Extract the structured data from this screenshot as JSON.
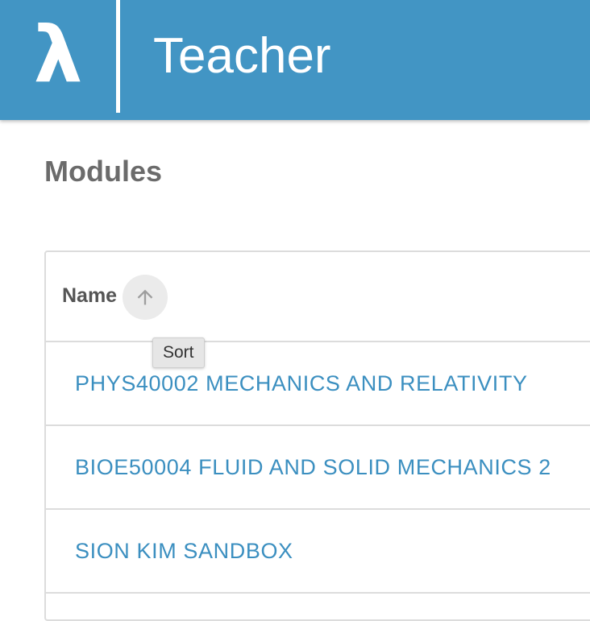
{
  "header": {
    "logo_glyph": "λ",
    "app_title": "Teacher",
    "brand_color": "#4295c4"
  },
  "page": {
    "title": "Modules"
  },
  "table": {
    "columns": [
      {
        "label": "Name",
        "sort_icon": "arrow-up-icon"
      }
    ],
    "tooltip": "Sort",
    "rows": [
      {
        "name": "PHYS40002 MECHANICS AND RELATIVITY"
      },
      {
        "name": "BIOE50004 FLUID AND SOLID MECHANICS 2"
      },
      {
        "name": "SION KIM SANDBOX"
      }
    ],
    "link_color": "#3b8fc0"
  }
}
